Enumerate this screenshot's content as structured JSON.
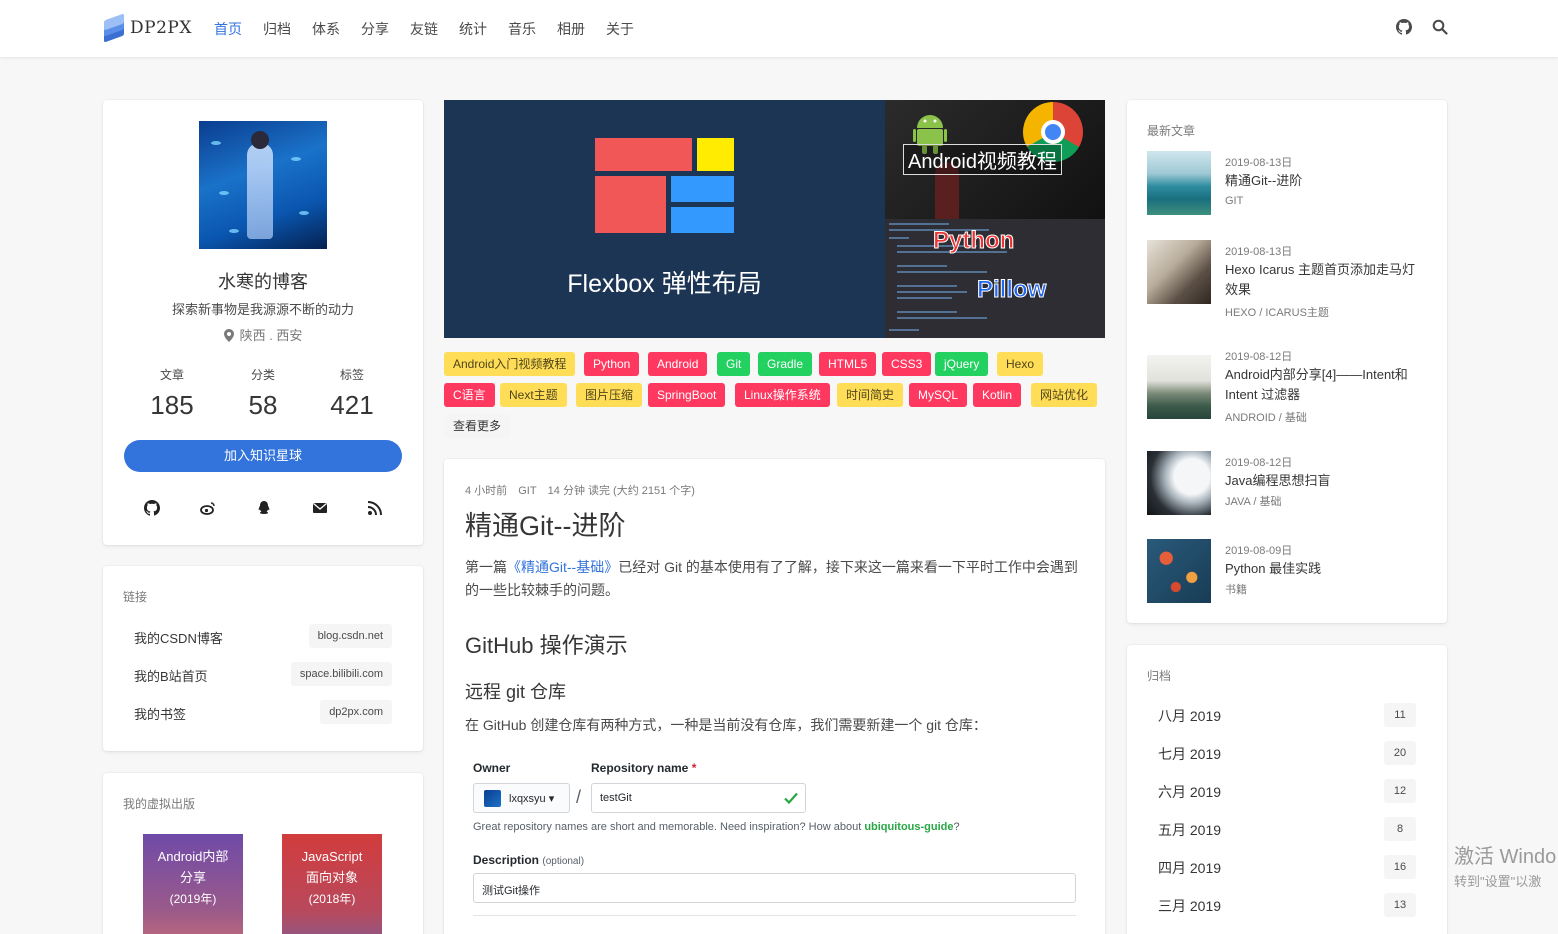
{
  "nav": {
    "brand": "DP2PX",
    "items": [
      "首页",
      "归档",
      "体系",
      "分享",
      "友链",
      "统计",
      "音乐",
      "相册",
      "关于"
    ],
    "active_index": 0,
    "right_icons": [
      "github-icon",
      "search-icon"
    ]
  },
  "profile": {
    "name": "水寒的博客",
    "motto": "探索新事物是我源源不断的动力",
    "location": "陕西 . 西安",
    "stats": [
      {
        "label": "文章",
        "value": "185"
      },
      {
        "label": "分类",
        "value": "58"
      },
      {
        "label": "标签",
        "value": "421"
      }
    ],
    "join_button": "加入知识星球",
    "social_icons": [
      "github-icon",
      "weibo-icon",
      "qq-icon",
      "email-icon",
      "rss-icon"
    ]
  },
  "links": {
    "title": "链接",
    "items": [
      {
        "name": "我的CSDN博客",
        "url": "blog.csdn.net"
      },
      {
        "name": "我的B站首页",
        "url": "space.bilibili.com"
      },
      {
        "name": "我的书签",
        "url": "dp2px.com"
      }
    ]
  },
  "publications": {
    "title": "我的虚拟出版",
    "books": [
      {
        "line1": "Android内部",
        "line2": "分享",
        "year": "(2019年)"
      },
      {
        "line1": "JavaScript",
        "line2": "面向对象",
        "year": "(2018年)"
      }
    ]
  },
  "banner": {
    "left_title": "Flexbox 弹性布局",
    "right_top_title": "Android视频教程",
    "python": "Python",
    "pillow": "Pillow"
  },
  "tags": {
    "row1": [
      {
        "t": "Android入门视频教程",
        "c": "y"
      },
      {
        "t": "Python",
        "c": "r"
      },
      {
        "t": "Android",
        "c": "r"
      },
      {
        "t": "Git",
        "c": "g"
      },
      {
        "t": "Gradle",
        "c": "g"
      },
      {
        "t": "HTML5",
        "c": "r"
      },
      {
        "t": "CSS3",
        "c": "r"
      },
      {
        "t": "jQuery",
        "c": "g"
      },
      {
        "t": "Hexo",
        "c": "y"
      }
    ],
    "row2": [
      {
        "t": "C语言",
        "c": "r"
      },
      {
        "t": "Next主题",
        "c": "y"
      },
      {
        "t": "图片压缩",
        "c": "y"
      },
      {
        "t": "SpringBoot",
        "c": "r"
      },
      {
        "t": "Linux操作系统",
        "c": "r"
      },
      {
        "t": "时间简史",
        "c": "y"
      },
      {
        "t": "MySQL",
        "c": "r"
      },
      {
        "t": "Kotlin",
        "c": "r"
      },
      {
        "t": "网站优化",
        "c": "y"
      }
    ],
    "more": "查看更多"
  },
  "article": {
    "time": "4 小时前",
    "category": "GIT",
    "read": "14 分钟 读完 (大约 2151 个字)",
    "title": "精通Git--进阶",
    "intro_before": "第一篇",
    "intro_link": "《精通Git--基础》",
    "intro_after": "已经对 Git 的基本使用有了了解，接下来这一篇来看一下平时工作中会遇到的一些比较棘手的问题。",
    "h2": "GitHub 操作演示",
    "h3": "远程 git 仓库",
    "p2": "在 GitHub 创建仓库有两种方式，一种是当前没有仓库，我们需要新建一个 git 仓库：",
    "github_form": {
      "owner_label": "Owner",
      "repo_label": "Repository name",
      "required_mark": "*",
      "owner_value": "lxqxsyu ▾",
      "slash": "/",
      "repo_value": "testGit",
      "hint_before": "Great repository names are short and memorable. Need inspiration? How about ",
      "hint_suggestion": "ubiquitous-guide",
      "hint_after": "?",
      "desc_label": "Description",
      "desc_optional": "(optional)",
      "desc_value": "测试Git操作"
    }
  },
  "recent": {
    "title": "最新文章",
    "posts": [
      {
        "date": "2019-08-13日",
        "title": "精通Git--进阶",
        "cat": "GIT"
      },
      {
        "date": "2019-08-13日",
        "title": "Hexo Icarus 主题首页添加走马灯效果",
        "cat": "HEXO / ICARUS主题"
      },
      {
        "date": "2019-08-12日",
        "title": "Android内部分享[4]——Intent和 Intent 过滤器",
        "cat": "ANDROID / 基础"
      },
      {
        "date": "2019-08-12日",
        "title": "Java编程思想扫盲",
        "cat": "JAVA / 基础"
      },
      {
        "date": "2019-08-09日",
        "title": "Python 最佳实践",
        "cat": "书籍"
      }
    ]
  },
  "archive": {
    "title": "归档",
    "items": [
      {
        "month": "八月 2019",
        "count": "11"
      },
      {
        "month": "七月 2019",
        "count": "20"
      },
      {
        "month": "六月 2019",
        "count": "12"
      },
      {
        "month": "五月 2019",
        "count": "8"
      },
      {
        "month": "四月 2019",
        "count": "16"
      },
      {
        "month": "三月 2019",
        "count": "13"
      }
    ]
  },
  "watermark": {
    "line1": "激活 Windo",
    "line2": "转到\"设置\"以激"
  },
  "colors": {
    "primary": "#3273dc",
    "tag_yellow": "#ffdd57",
    "tag_red": "#ff3860",
    "tag_green": "#23d160"
  }
}
